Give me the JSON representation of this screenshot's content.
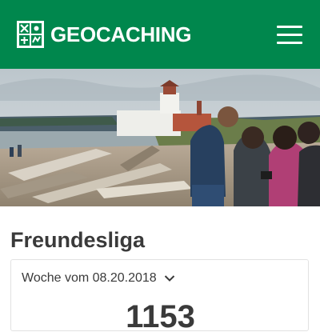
{
  "header": {
    "brand": "GEOCACHING",
    "logo_icon": "geocaching-logo-icon",
    "menu_icon": "hamburger-menu-icon",
    "background": "#00874d"
  },
  "hero": {
    "image": "people-with-smartphone-on-driftwood-beach-near-lighthouse"
  },
  "leaderboard": {
    "title": "Freundesliga",
    "week_label": "Woche vom 08.20.2018",
    "week_icon": "chevron-down-icon",
    "count": "1153"
  }
}
